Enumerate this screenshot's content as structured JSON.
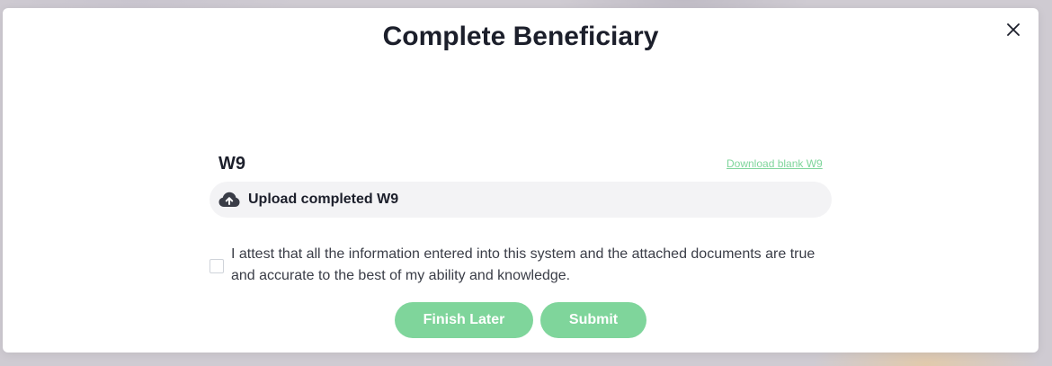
{
  "modal": {
    "title": "Complete Beneficiary",
    "close_icon": "close-icon"
  },
  "w9": {
    "label": "W9",
    "download_link": "Download blank W9",
    "upload_label": "Upload completed W9",
    "upload_icon": "cloud-upload-icon"
  },
  "attestation": {
    "text": "I attest that all the information entered into this system and the attached documents are true and accurate to the best of my ability and knowledge.",
    "checked": false
  },
  "actions": {
    "finish_later_label": "Finish Later",
    "submit_label": "Submit"
  },
  "colors": {
    "accent": "#7fd59b",
    "title_text": "#1c1f2b",
    "upload_bg": "#f3f3f5"
  }
}
